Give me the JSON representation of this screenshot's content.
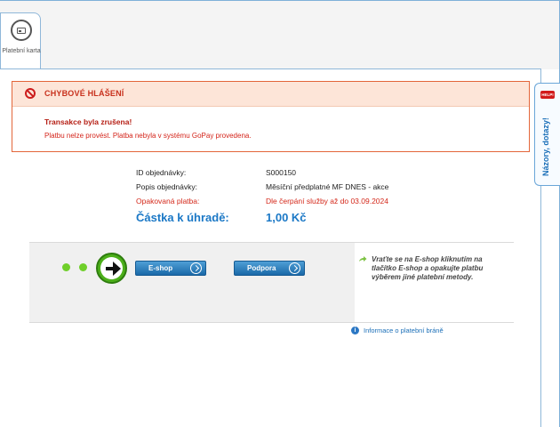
{
  "tab": {
    "label": "Platební karta",
    "icon": "credit-card-icon"
  },
  "error": {
    "title": "CHYBOVÉ HLÁŠENÍ",
    "heading": "Transakce byla zrušena!",
    "message": "Platbu nelze provést. Platba nebyla v systému GoPay provedena.",
    "icon": "no-entry-icon",
    "color": "#d4241a"
  },
  "order": {
    "id_label": "ID objednávky:",
    "id_value": "S000150",
    "desc_label": "Popis objednávky:",
    "desc_value": "Měsíční předplatné MF DNES - akce",
    "repeat_label": "Opakovaná platba:",
    "repeat_value": "Dle čerpání služby až do 03.09.2024",
    "amount_label": "Částka k úhradě:",
    "amount_value": "1,00 Kč"
  },
  "actions": {
    "eshop_label": "E-shop",
    "support_label": "Podpora",
    "note": "Vraťte se na E-shop kliknutím na tlačítko E-shop a opakujte platbu výběrem jiné platební metody."
  },
  "info_link": "Informace o platební bráně",
  "feedback": {
    "badge": "HELP!",
    "label": "Názory, dotazy!"
  }
}
